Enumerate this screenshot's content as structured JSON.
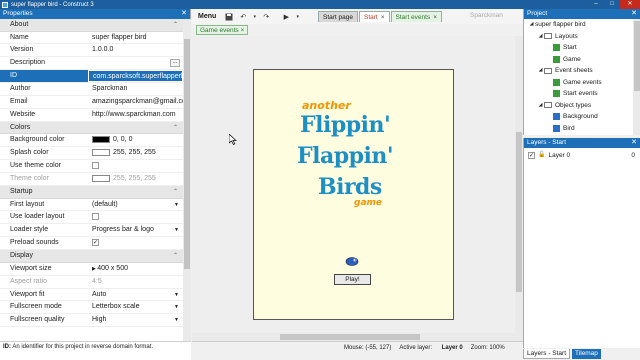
{
  "window": {
    "title": "super flapper bird - Construct 3",
    "controls": [
      "–",
      "□",
      "✕"
    ]
  },
  "properties": {
    "header": "Properties",
    "sections": [
      {
        "title": "About",
        "rows": [
          {
            "name": "Name",
            "value": "super flapper bird"
          },
          {
            "name": "Version",
            "value": "1.0.0.0"
          },
          {
            "name": "Description",
            "value": "",
            "button": "..."
          },
          {
            "name": "ID",
            "value": "com.sparcksoft.superflapperbird",
            "selected": true
          },
          {
            "name": "Author",
            "value": "Sparckman"
          },
          {
            "name": "Email",
            "value": "amazingsparckman@gmail.com"
          },
          {
            "name": "Website",
            "value": "http://www.sparckman.com"
          }
        ]
      },
      {
        "title": "Colors",
        "rows": [
          {
            "name": "Background color",
            "value": "0, 0, 0",
            "swatch": "#000000"
          },
          {
            "name": "Splash color",
            "value": "255, 255, 255",
            "swatch": "#ffffff"
          },
          {
            "name": "Use theme color",
            "value": "",
            "checkbox": false
          },
          {
            "name": "Theme color",
            "value": "255, 255, 255",
            "swatch": "#ffffff",
            "dim": true
          }
        ]
      },
      {
        "title": "Startup",
        "rows": [
          {
            "name": "First layout",
            "value": "(default)",
            "dropdown": true
          },
          {
            "name": "Use loader layout",
            "value": "",
            "checkbox": false
          },
          {
            "name": "Loader style",
            "value": "Progress bar & logo",
            "dropdown": true
          },
          {
            "name": "Preload sounds",
            "value": "",
            "checkbox": true
          }
        ]
      },
      {
        "title": "Display",
        "rows": [
          {
            "name": "Viewport size",
            "value": "400 x 500",
            "expander": true
          },
          {
            "name": "Aspect ratio",
            "value": "4:5",
            "dim": true
          },
          {
            "name": "Viewport fit",
            "value": "Auto",
            "dropdown": true
          },
          {
            "name": "Fullscreen mode",
            "value": "Letterbox scale",
            "dropdown": true
          },
          {
            "name": "Fullscreen quality",
            "value": "High",
            "dropdown": true
          }
        ]
      }
    ],
    "status_label": "ID:",
    "status_text": "An identifier for this project in reverse domain format."
  },
  "toolbar": {
    "menu_label": "Menu",
    "icons": [
      "save-icon",
      "undo-icon",
      "redo-icon",
      "play-icon"
    ]
  },
  "tabs": [
    {
      "label": "Start page",
      "type": "normal"
    },
    {
      "label": "Start",
      "type": "start"
    },
    {
      "label": "Start events",
      "type": "events"
    }
  ],
  "user": "Sparckman",
  "subtab": "Game events",
  "layout": {
    "logo_line1": "another",
    "logo_line2": "Flippin'",
    "logo_line3": "Flappin'",
    "logo_line4": "Birds",
    "logo_line5": "game",
    "play_button": "Play!"
  },
  "status": {
    "mouse": "Mouse: (-55, 127)",
    "active_layer_label": "Active layer:",
    "active_layer": "Layer 0",
    "zoom": "Zoom: 100%"
  },
  "project": {
    "header": "Project",
    "tree": [
      {
        "label": "super flapper bird",
        "level": 0,
        "kind": "root"
      },
      {
        "label": "Layouts",
        "level": 1,
        "kind": "folder"
      },
      {
        "label": "Start",
        "level": 2,
        "kind": "layout"
      },
      {
        "label": "Game",
        "level": 2,
        "kind": "layout"
      },
      {
        "label": "Event sheets",
        "level": 1,
        "kind": "folder"
      },
      {
        "label": "Game events",
        "level": 2,
        "kind": "events"
      },
      {
        "label": "Start events",
        "level": 2,
        "kind": "events"
      },
      {
        "label": "Object types",
        "level": 1,
        "kind": "folder"
      },
      {
        "label": "Background",
        "level": 2,
        "kind": "object"
      },
      {
        "label": "Bird",
        "level": 2,
        "kind": "object"
      }
    ]
  },
  "layers": {
    "header": "Layers - Start",
    "rows": [
      {
        "name": "Layer 0",
        "index": "0"
      }
    ]
  },
  "bottom_tabs": [
    "Layers - Start",
    "Tilemap"
  ],
  "colors": {
    "accent": "#1d6fb8",
    "logo_orange": "#f29400",
    "logo_blue": "#1d8fc4",
    "layout_bg": "#fefde0"
  }
}
